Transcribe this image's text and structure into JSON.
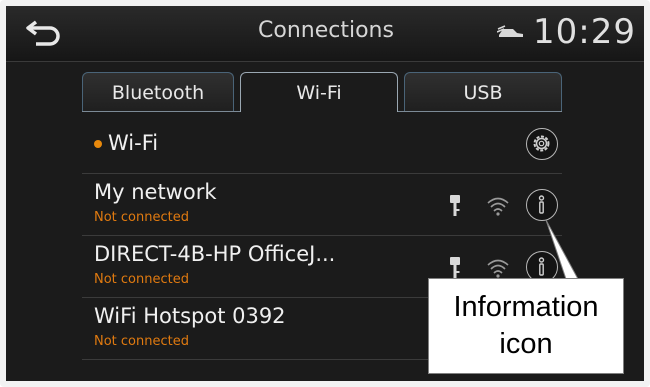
{
  "header": {
    "title": "Connections",
    "time": "10:29"
  },
  "tabs": [
    {
      "label": "Bluetooth",
      "active": false
    },
    {
      "label": "Wi-Fi",
      "active": true
    },
    {
      "label": "USB",
      "active": false
    }
  ],
  "wifi_toggle": {
    "label": "Wi-Fi",
    "status_dot_color": "#e8890c"
  },
  "networks": [
    {
      "name": "My network",
      "status": "Not connected",
      "icons": [
        "key-icon",
        "wifi-signal-icon",
        "info-icon"
      ]
    },
    {
      "name": "DIRECT-4B-HP OfficeJ...",
      "status": "Not connected",
      "icons": [
        "key-icon",
        "wifi-signal-icon",
        "info-icon"
      ]
    },
    {
      "name": "WiFi Hotspot 0392",
      "status": "Not connected",
      "icons": []
    }
  ],
  "callout": {
    "line1": "Information",
    "line2": "icon"
  },
  "colors": {
    "accent_orange": "#e07a10",
    "background": "#1b1b1b",
    "tab_border": "#4a6478"
  }
}
